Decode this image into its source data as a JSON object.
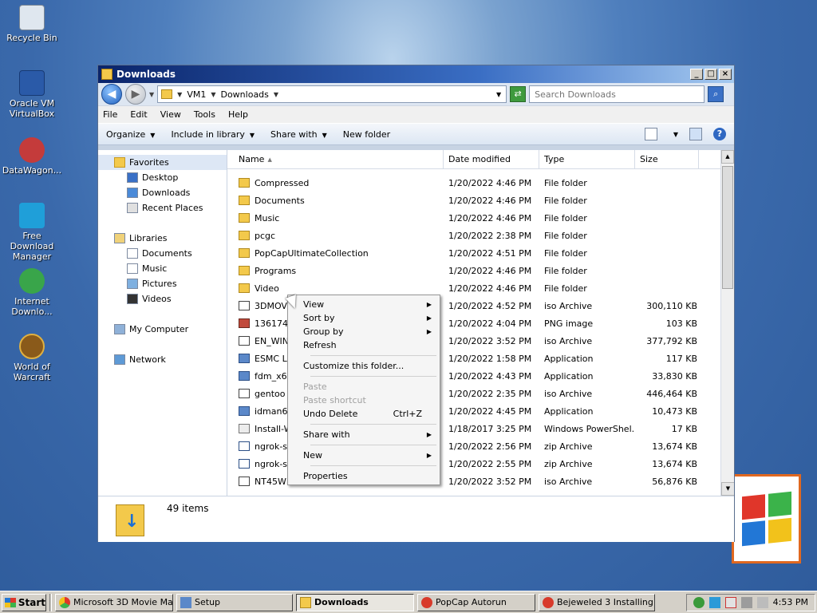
{
  "desktop": {
    "icons": [
      {
        "label": "Recycle Bin"
      },
      {
        "label": "Oracle VM VirtualBox"
      },
      {
        "label": "DataWagon..."
      },
      {
        "label": "Free Download Manager"
      },
      {
        "label": "Internet Downlo..."
      },
      {
        "label": "World of Warcraft"
      }
    ]
  },
  "window": {
    "title": "Downloads",
    "address": {
      "crumb1": "VM1",
      "crumb2": "Downloads"
    },
    "search_placeholder": "Search Downloads",
    "menu": [
      "File",
      "Edit",
      "View",
      "Tools",
      "Help"
    ],
    "toolbar": {
      "organize": "Organize",
      "include": "Include in library",
      "share": "Share with",
      "newfolder": "New folder"
    },
    "nav": {
      "favorites": "Favorites",
      "desktop": "Desktop",
      "downloads": "Downloads",
      "recent": "Recent Places",
      "libraries": "Libraries",
      "documents": "Documents",
      "music": "Music",
      "pictures": "Pictures",
      "videos": "Videos",
      "computer": "My Computer",
      "network": "Network"
    },
    "columns": {
      "name": "Name",
      "date": "Date modified",
      "type": "Type",
      "size": "Size"
    },
    "files": [
      {
        "name": "Compressed",
        "date": "1/20/2022 4:46 PM",
        "type": "File folder",
        "size": "",
        "icon": "folder"
      },
      {
        "name": "Documents",
        "date": "1/20/2022 4:46 PM",
        "type": "File folder",
        "size": "",
        "icon": "folder"
      },
      {
        "name": "Music",
        "date": "1/20/2022 4:46 PM",
        "type": "File folder",
        "size": "",
        "icon": "folder"
      },
      {
        "name": "pcgc",
        "date": "1/20/2022 2:38 PM",
        "type": "File folder",
        "size": "",
        "icon": "folder"
      },
      {
        "name": "PopCapUltimateCollection",
        "date": "1/20/2022 4:51 PM",
        "type": "File folder",
        "size": "",
        "icon": "folder"
      },
      {
        "name": "Programs",
        "date": "1/20/2022 4:46 PM",
        "type": "File folder",
        "size": "",
        "icon": "folder"
      },
      {
        "name": "Video",
        "date": "1/20/2022 4:46 PM",
        "type": "File folder",
        "size": "",
        "icon": "folder"
      },
      {
        "name": "3DMOVI",
        "date": "1/20/2022 4:52 PM",
        "type": "iso Archive",
        "size": "300,110 KB",
        "icon": "iso"
      },
      {
        "name": "136174",
        "date": "1/20/2022 4:04 PM",
        "type": "PNG image",
        "size": "103 KB",
        "icon": "png"
      },
      {
        "name": "EN_WIN",
        "date": "1/20/2022 3:52 PM",
        "type": "iso Archive",
        "size": "377,792 KB",
        "icon": "iso"
      },
      {
        "name": "ESMC La",
        "date": "1/20/2022 1:58 PM",
        "type": "Application",
        "size": "117 KB",
        "icon": "app"
      },
      {
        "name": "fdm_x6",
        "date": "1/20/2022 4:43 PM",
        "type": "Application",
        "size": "33,830 KB",
        "icon": "app"
      },
      {
        "name": "gentoo",
        "date": "1/20/2022 2:35 PM",
        "type": "iso Archive",
        "size": "446,464 KB",
        "icon": "iso"
      },
      {
        "name": "idman64",
        "date": "1/20/2022 4:45 PM",
        "type": "Application",
        "size": "10,473 KB",
        "icon": "app"
      },
      {
        "name": "Install-W",
        "date": "1/18/2017 3:25 PM",
        "type": "Windows PowerShel...",
        "size": "17 KB",
        "icon": "ps"
      },
      {
        "name": "ngrok-st",
        "date": "1/20/2022 2:56 PM",
        "type": "zip Archive",
        "size": "13,674 KB",
        "icon": "zip"
      },
      {
        "name": "ngrok-st",
        "date": "1/20/2022 2:55 PM",
        "type": "zip Archive",
        "size": "13,674 KB",
        "icon": "zip"
      },
      {
        "name": "NT45WK",
        "date": "1/20/2022 3:52 PM",
        "type": "iso Archive",
        "size": "56,876 KB",
        "icon": "iso"
      }
    ],
    "status": "49 items"
  },
  "context_menu": {
    "view": "View",
    "sortby": "Sort by",
    "groupby": "Group by",
    "refresh": "Refresh",
    "customize": "Customize this folder...",
    "paste": "Paste",
    "paste_shortcut": "Paste shortcut",
    "undo_delete": "Undo Delete",
    "undo_shortcut": "Ctrl+Z",
    "share_with": "Share with",
    "new": "New",
    "properties": "Properties"
  },
  "taskbar": {
    "start": "Start",
    "tasks": [
      {
        "label": "Microsoft 3D Movie Ma...",
        "active": false
      },
      {
        "label": "Setup",
        "active": false
      },
      {
        "label": "Downloads",
        "active": true
      },
      {
        "label": "PopCap Autorun",
        "active": false
      },
      {
        "label": "Bejeweled 3 Installing ...",
        "active": false
      }
    ],
    "clock": "4:53 PM"
  }
}
